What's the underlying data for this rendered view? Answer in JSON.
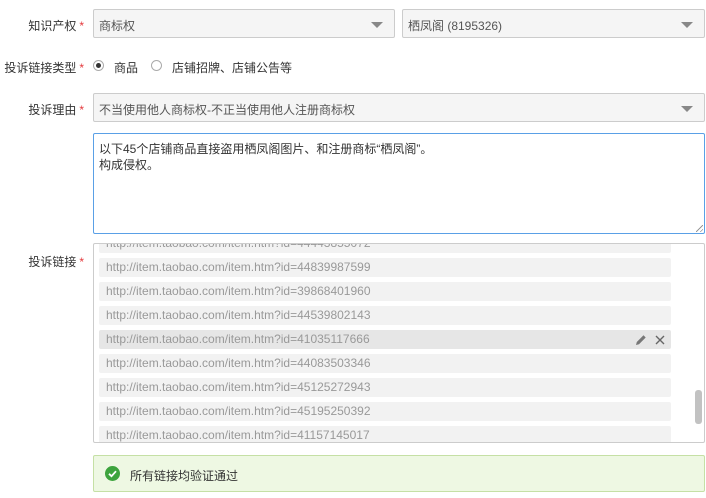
{
  "ip_right": {
    "label": "知识产权",
    "required_mark": "*",
    "type_value": "商标权",
    "store_value": "栖凤阁 (8195326)"
  },
  "link_type": {
    "label": "投诉链接类型",
    "required_mark": "*",
    "options": [
      {
        "label": "商品",
        "selected": true
      },
      {
        "label": "店铺招牌、店铺公告等",
        "selected": false
      }
    ]
  },
  "reason": {
    "label": "投诉理由",
    "required_mark": "*",
    "value": "不当使用他人商标权-不正当使用他人注册商标权",
    "description_line1": "以下45个店铺商品直接盗用栖凤阁图片、和注册商标“栖凤阁”。",
    "description_line2": "构成侵权。"
  },
  "links": {
    "label": "投诉链接",
    "required_mark": "*",
    "items": [
      "http://item.taobao.com/item.htm?id=44839987599",
      "http://item.taobao.com/item.htm?id=39868401960",
      "http://item.taobao.com/item.htm?id=44539802143",
      "http://item.taobao.com/item.htm?id=41035117666",
      "http://item.taobao.com/item.htm?id=44083503346",
      "http://item.taobao.com/item.htm?id=45125272943",
      "http://item.taobao.com/item.htm?id=45195250392",
      "http://item.taobao.com/item.htm?id=41157145017"
    ]
  },
  "validation": {
    "message": "所有链接均验证通过"
  },
  "colors": {
    "required": "#e4393c",
    "success_bg": "#eef8e3",
    "success_icon": "#3da43d",
    "focus_border": "#5aa0e6"
  }
}
